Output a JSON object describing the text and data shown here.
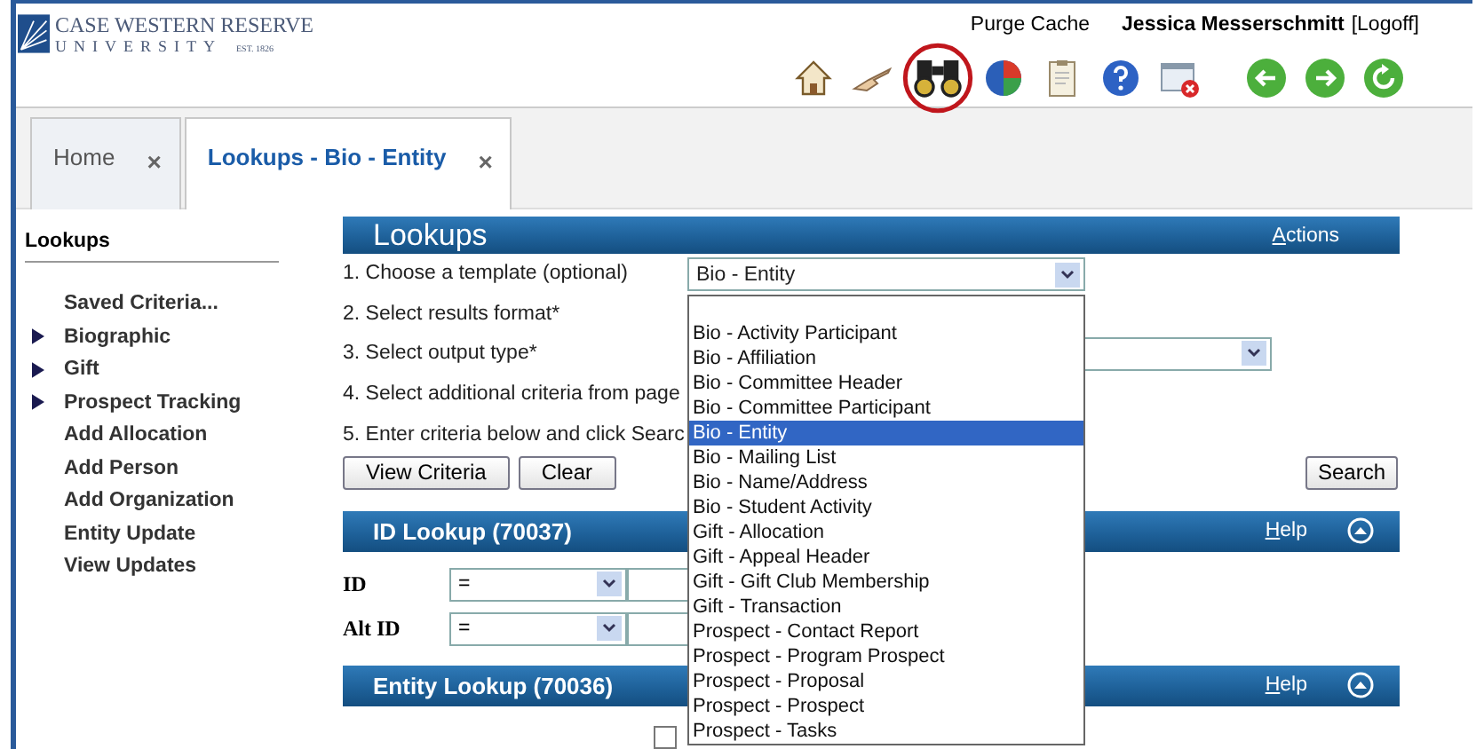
{
  "header": {
    "logo": {
      "name": "CASE WESTERN RESERVE",
      "sub": "UNIVERSITY",
      "est": "EST. 1826"
    },
    "purge": "Purge Cache",
    "user": "Jessica Messerschmitt",
    "logoff": "[Logoff]",
    "toolbar": [
      {
        "kind": "home",
        "selected": false
      },
      {
        "kind": "hand",
        "selected": false
      },
      {
        "kind": "binoculars",
        "selected": true
      },
      {
        "kind": "pie",
        "selected": false
      },
      {
        "kind": "clipboard",
        "selected": false
      },
      {
        "kind": "help",
        "selected": false
      },
      {
        "kind": "close-window",
        "selected": false
      },
      {
        "kind": "back",
        "selected": false
      },
      {
        "kind": "forward",
        "selected": false
      },
      {
        "kind": "refresh",
        "selected": false
      }
    ]
  },
  "tabs": [
    {
      "label": "Home",
      "close": "×",
      "selected": false
    },
    {
      "label": "Lookups - Bio - Entity",
      "close": "×",
      "selected": true
    }
  ],
  "sidebar": {
    "title": "Lookups",
    "items": [
      {
        "label": "Saved Criteria...",
        "expandable": false
      },
      {
        "label": "Biographic",
        "expandable": true
      },
      {
        "label": "Gift",
        "expandable": true
      },
      {
        "label": "Prospect Tracking",
        "expandable": true
      },
      {
        "label": "Add Allocation",
        "expandable": false
      },
      {
        "label": "Add Person",
        "expandable": false
      },
      {
        "label": "Add Organization",
        "expandable": false
      },
      {
        "label": "Entity Update",
        "expandable": false
      },
      {
        "label": "View Updates",
        "expandable": false
      }
    ]
  },
  "lookups": {
    "title": "Lookups",
    "actions": "Actions",
    "steps": [
      "1. Choose a template (optional)",
      "2. Select results format*",
      "3. Select output type*",
      "4. Select additional criteria from page",
      "5. Enter criteria below and click Searc"
    ],
    "template_select": {
      "value": "Bio - Entity",
      "expanded": true,
      "options": [
        {
          "label": "Bio - Activity Participant",
          "selected": false
        },
        {
          "label": "Bio - Affiliation",
          "selected": false
        },
        {
          "label": "Bio - Committee Header",
          "selected": false
        },
        {
          "label": "Bio - Committee Participant",
          "selected": false
        },
        {
          "label": "Bio - Entity",
          "selected": true
        },
        {
          "label": "Bio - Mailing List",
          "selected": false
        },
        {
          "label": "Bio - Name/Address",
          "selected": false
        },
        {
          "label": "Bio - Student Activity",
          "selected": false
        },
        {
          "label": "Gift - Allocation",
          "selected": false
        },
        {
          "label": "Gift - Appeal Header",
          "selected": false
        },
        {
          "label": "Gift - Gift Club Membership",
          "selected": false
        },
        {
          "label": "Gift - Transaction",
          "selected": false
        },
        {
          "label": "Prospect - Contact Report",
          "selected": false
        },
        {
          "label": "Prospect - Program Prospect",
          "selected": false
        },
        {
          "label": "Prospect - Proposal",
          "selected": false
        },
        {
          "label": "Prospect - Prospect",
          "selected": false
        },
        {
          "label": "Prospect - Tasks",
          "selected": false
        }
      ]
    },
    "buttons": [
      "View Criteria",
      "Clear"
    ],
    "search": "Search"
  },
  "id_lookup": {
    "title": "ID Lookup (70037)",
    "help": "Help",
    "fields": [
      {
        "label": "ID",
        "operator": "="
      },
      {
        "label": "Alt ID",
        "operator": "="
      }
    ]
  },
  "entity_lookup": {
    "title": "Entity Lookup (70036)",
    "help": "Help",
    "checkbox": {
      "checked": false
    }
  }
}
